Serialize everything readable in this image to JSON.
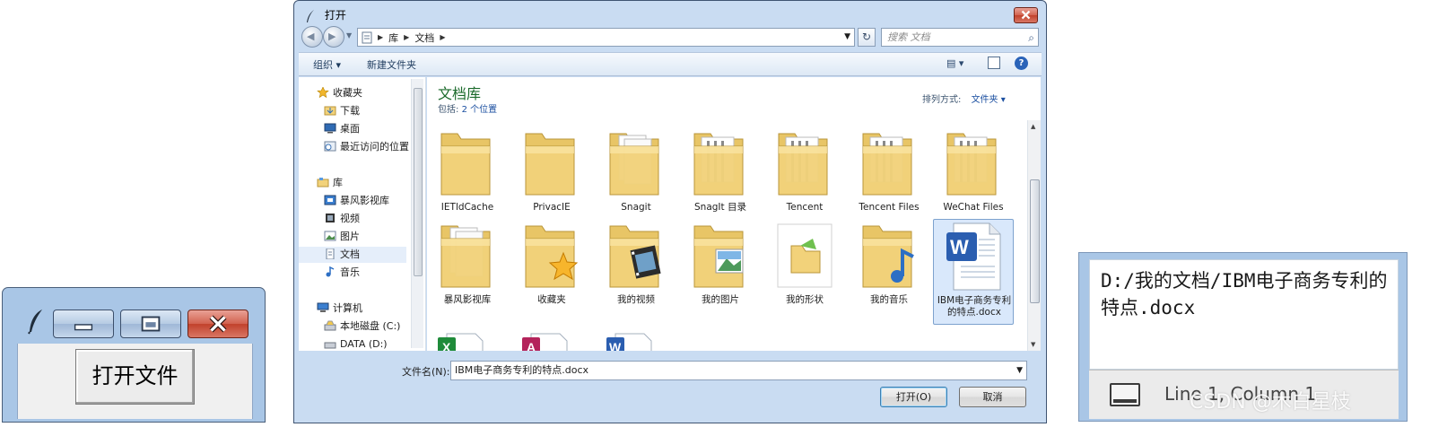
{
  "tk_window": {
    "open_button_label": "打开文件"
  },
  "dialog": {
    "title": "打开",
    "address_path": [
      "库",
      "文档"
    ],
    "search_placeholder": "搜索 文档",
    "toolbar": {
      "organize": "组织 ▾",
      "new_folder": "新建文件夹"
    },
    "nav": {
      "favorites": "收藏夹",
      "favorites_items": [
        "下载",
        "桌面",
        "最近访问的位置"
      ],
      "libraries": "库",
      "libraries_items": [
        "暴风影视库",
        "视频",
        "图片",
        "文档",
        "音乐"
      ],
      "computer": "计算机",
      "computer_items": [
        "本地磁盘 (C:)",
        "DATA (D:)"
      ]
    },
    "library_title": "文档库",
    "library_includes_label": "包括:",
    "library_includes_link": "2 个位置",
    "arrange_label": "排列方式:",
    "arrange_value": "文件夹 ▾",
    "files": [
      {
        "label": "IETldCache",
        "kind": "folder"
      },
      {
        "label": "PrivacIE",
        "kind": "folder"
      },
      {
        "label": "Snagit",
        "kind": "folder"
      },
      {
        "label": "SnagIt 目录",
        "kind": "folder"
      },
      {
        "label": "Tencent",
        "kind": "folder"
      },
      {
        "label": "Tencent Files",
        "kind": "folder"
      },
      {
        "label": "WeChat Files",
        "kind": "folder"
      },
      {
        "label": "暴风影视库",
        "kind": "folder"
      },
      {
        "label": "收藏夹",
        "kind": "folder-star"
      },
      {
        "label": "我的视频",
        "kind": "folder-video"
      },
      {
        "label": "我的图片",
        "kind": "folder-picture"
      },
      {
        "label": "我的形状",
        "kind": "shapes"
      },
      {
        "label": "我的音乐",
        "kind": "folder-music"
      },
      {
        "label": "IBM电子商务专利的特点.docx",
        "kind": "word-doc"
      }
    ],
    "partial_files": [
      "excel-icon",
      "access-icon",
      "word-icon"
    ],
    "filename_label": "文件名(N):",
    "filename_value": "IBM电子商务专利的特点.docx",
    "open_button": "打开(O)",
    "cancel_button": "取消"
  },
  "editor": {
    "text": "D:/我的文档/IBM电子商务专利的特点.docx",
    "status": "Line 1, Column 1"
  },
  "watermark": "CSDN @木白星枝",
  "colors": {
    "window_frame": "#a9c6e6",
    "close_red": "#c1412b",
    "library_title_green": "#1b6a2b",
    "link_blue": "#1b4fa0",
    "folder_yellow": "#f2d27a"
  }
}
